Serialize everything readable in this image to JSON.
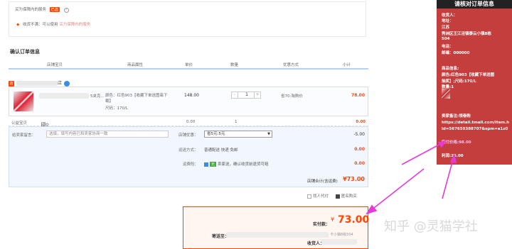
{
  "service": {
    "title": "买为保障内的服务",
    "badge": "已选",
    "help": "?",
    "line": "收货不满：可以使用",
    "link": "买为保障内的服务"
  },
  "order": {
    "title": "确认订单信息",
    "headers": [
      "店铺宝贝",
      "商品属性",
      "单价",
      "数量",
      "优惠方式",
      "小计"
    ],
    "shop_suffix": "店",
    "item": {
      "name_suffix": "5夹克...",
      "attr_line1": "颜色：红色903【收藏下单送图串下载】",
      "attr_line2": "尺码：170/L",
      "price": "148.00",
      "qty_minus": "-",
      "qty": "1",
      "qty_plus": "+",
      "discount": "省70:淘购价",
      "subtotal": "78.00"
    },
    "insurance": {
      "label": "公益宝贝",
      "text": "成交后卖家将捐赠0.02元给公益宝贝计划",
      "price": "0.00",
      "qty": "1",
      "amount": "0.00"
    }
  },
  "checkout": {
    "message_label": "给卖家留言：",
    "message_placeholder": "选填，填写内容已和卖家协商一致",
    "coupon_label": "店铺优惠：",
    "coupon_value": "省5元:5元",
    "coupon_amount": "-5.00",
    "shipping_label": "运送方式：",
    "shipping_value": "普通配送 快递 免邮",
    "shipping_amount": "0.00",
    "freight_label": "运费险：",
    "freight_tag": "无",
    "freight_text": "卖家送，确认收货前退货可赔",
    "freight_amount": "0.00",
    "total_label": "店铺合计(含运费)",
    "total_value": "¥73.00",
    "opt_proxy": "找人代付",
    "opt_anon": "匿名购买"
  },
  "payment": {
    "paid_label": "实付款：",
    "currency": "¥",
    "amount": "73.00",
    "ship_label": "寄送至：",
    "ship_suffix": "卡小镇8栋504",
    "recv_label": "收货人："
  },
  "panel": {
    "title": "请核对订单信息",
    "lines": [
      "收货人：",
      "地址：",
      "江苏",
      "秀洲区王江泾镇泰云小镇8栋",
      "504",
      "电话：",
      "邮编：000000",
      "",
      "商品信息:",
      "颜色:红色903【收藏下单送图",
      "抽奖】;尺码:170/L",
      "数量:1"
    ],
    "note_label": "卖家备注:领卷购",
    "url1": "https://detail.tmall.com/item.h",
    "url2": "id=567659388707&spm=a1z0",
    "sale_price": "实付价格:98.00",
    "profit": "利润:25.00"
  },
  "watermark": "知乎 @灵猫学社",
  "colors": {
    "accent": "#ff4400",
    "panel": "#c43e3e",
    "arrow": "#e63ad6"
  }
}
